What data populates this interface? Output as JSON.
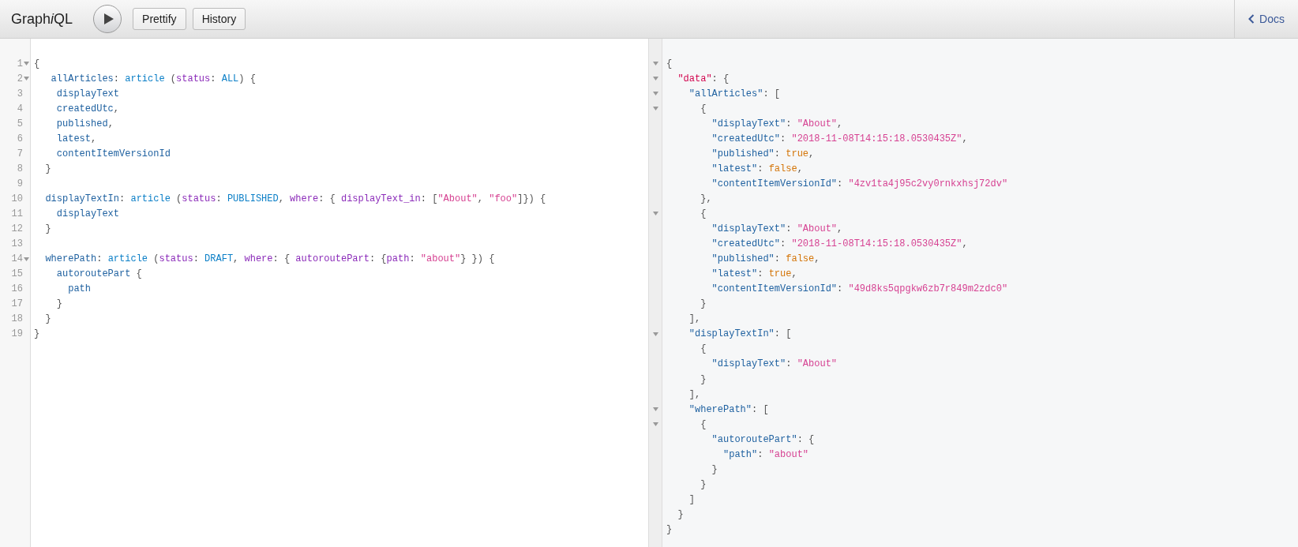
{
  "toolbar": {
    "title": [
      {
        "text": "Graph",
        "italic": false
      },
      {
        "text": "i",
        "italic": true
      },
      {
        "text": "QL",
        "italic": false
      }
    ],
    "buttons": [
      "Prettify",
      "History"
    ],
    "docs": "Docs"
  },
  "query_editor": {
    "lines": [
      {
        "number": "1",
        "foldable": true,
        "tokens": [
          {
            "kind": "punctuation",
            "text": "{"
          }
        ]
      },
      {
        "number": "2",
        "foldable": true,
        "tokens": [
          {
            "kind": "property",
            "text": "   allArticles"
          },
          {
            "kind": "punctuation",
            "text": ": "
          },
          {
            "kind": "type",
            "text": "article"
          },
          {
            "kind": "punctuation",
            "text": " ("
          },
          {
            "kind": "attribute",
            "text": "status"
          },
          {
            "kind": "punctuation",
            "text": ": "
          },
          {
            "kind": "enum",
            "text": "ALL"
          },
          {
            "kind": "punctuation",
            "text": ") {"
          }
        ]
      },
      {
        "number": "3",
        "foldable": false,
        "tokens": [
          {
            "kind": "property",
            "text": "    displayText"
          }
        ]
      },
      {
        "number": "4",
        "foldable": false,
        "tokens": [
          {
            "kind": "property",
            "text": "    createdUtc"
          },
          {
            "kind": "punctuation",
            "text": ","
          }
        ]
      },
      {
        "number": "5",
        "foldable": false,
        "tokens": [
          {
            "kind": "property",
            "text": "    published"
          },
          {
            "kind": "punctuation",
            "text": ","
          }
        ]
      },
      {
        "number": "6",
        "foldable": false,
        "tokens": [
          {
            "kind": "property",
            "text": "    latest"
          },
          {
            "kind": "punctuation",
            "text": ","
          }
        ]
      },
      {
        "number": "7",
        "foldable": false,
        "tokens": [
          {
            "kind": "property",
            "text": "    contentItemVersionId"
          }
        ]
      },
      {
        "number": "8",
        "foldable": false,
        "tokens": [
          {
            "kind": "punctuation",
            "text": "  }"
          }
        ]
      },
      {
        "number": "9",
        "foldable": false
      },
      {
        "number": "10",
        "foldable": false,
        "tokens": [
          {
            "kind": "property",
            "text": "  displayTextIn"
          },
          {
            "kind": "punctuation",
            "text": ": "
          },
          {
            "kind": "type",
            "text": "article"
          },
          {
            "kind": "punctuation",
            "text": " ("
          },
          {
            "kind": "attribute",
            "text": "status"
          },
          {
            "kind": "punctuation",
            "text": ": "
          },
          {
            "kind": "enum",
            "text": "PUBLISHED"
          },
          {
            "kind": "punctuation",
            "text": ", "
          },
          {
            "kind": "attribute",
            "text": "where"
          },
          {
            "kind": "punctuation",
            "text": ": { "
          },
          {
            "kind": "attribute",
            "text": "displayText_in"
          },
          {
            "kind": "punctuation",
            "text": ": ["
          },
          {
            "kind": "string",
            "text": "\"About\""
          },
          {
            "kind": "punctuation",
            "text": ", "
          },
          {
            "kind": "string",
            "text": "\"foo\""
          },
          {
            "kind": "punctuation",
            "text": "]}) {"
          }
        ]
      },
      {
        "number": "11",
        "foldable": false,
        "tokens": [
          {
            "kind": "property",
            "text": "    displayText"
          }
        ]
      },
      {
        "number": "12",
        "foldable": false,
        "tokens": [
          {
            "kind": "punctuation",
            "text": "  }"
          }
        ]
      },
      {
        "number": "13",
        "foldable": false
      },
      {
        "number": "14",
        "foldable": true,
        "tokens": [
          {
            "kind": "property",
            "text": "  wherePath"
          },
          {
            "kind": "punctuation",
            "text": ": "
          },
          {
            "kind": "type",
            "text": "article"
          },
          {
            "kind": "punctuation",
            "text": " ("
          },
          {
            "kind": "attribute",
            "text": "status"
          },
          {
            "kind": "punctuation",
            "text": ": "
          },
          {
            "kind": "enum",
            "text": "DRAFT"
          },
          {
            "kind": "punctuation",
            "text": ", "
          },
          {
            "kind": "attribute",
            "text": "where"
          },
          {
            "kind": "punctuation",
            "text": ": { "
          },
          {
            "kind": "attribute",
            "text": "autoroutePart"
          },
          {
            "kind": "punctuation",
            "text": ": {"
          },
          {
            "kind": "attribute",
            "text": "path"
          },
          {
            "kind": "punctuation",
            "text": ": "
          },
          {
            "kind": "string",
            "text": "\"about\""
          },
          {
            "kind": "punctuation",
            "text": "} }) {"
          }
        ]
      },
      {
        "number": "15",
        "foldable": false,
        "tokens": [
          {
            "kind": "property",
            "text": "    autoroutePart"
          },
          {
            "kind": "punctuation",
            "text": " {"
          }
        ]
      },
      {
        "number": "16",
        "foldable": false,
        "tokens": [
          {
            "kind": "property",
            "text": "      path"
          }
        ]
      },
      {
        "number": "17",
        "foldable": false,
        "tokens": [
          {
            "kind": "punctuation",
            "text": "    }"
          }
        ]
      },
      {
        "number": "18",
        "foldable": false,
        "tokens": [
          {
            "kind": "punctuation",
            "text": "  }"
          }
        ]
      },
      {
        "number": "19",
        "foldable": false,
        "tokens": [
          {
            "kind": "punctuation",
            "text": "}"
          }
        ]
      }
    ]
  },
  "result_viewer": {
    "lines": [
      {
        "foldable": true,
        "tokens": [
          {
            "kind": "punctuation",
            "text": "{"
          }
        ]
      },
      {
        "foldable": true,
        "tokens": [
          {
            "kind": "root-key",
            "text": "  \"data\""
          },
          {
            "kind": "punctuation",
            "text": ": {"
          }
        ]
      },
      {
        "foldable": true,
        "tokens": [
          {
            "kind": "property",
            "text": "    \"allArticles\""
          },
          {
            "kind": "punctuation",
            "text": ": ["
          }
        ]
      },
      {
        "foldable": true,
        "tokens": [
          {
            "kind": "punctuation",
            "text": "      {"
          }
        ]
      },
      {
        "foldable": false,
        "tokens": [
          {
            "kind": "property",
            "text": "        \"displayText\""
          },
          {
            "kind": "punctuation",
            "text": ": "
          },
          {
            "kind": "string",
            "text": "\"About\""
          },
          {
            "kind": "punctuation",
            "text": ","
          }
        ]
      },
      {
        "foldable": false,
        "tokens": [
          {
            "kind": "property",
            "text": "        \"createdUtc\""
          },
          {
            "kind": "punctuation",
            "text": ": "
          },
          {
            "kind": "string",
            "text": "\"2018-11-08T14:15:18.0530435Z\""
          },
          {
            "kind": "punctuation",
            "text": ","
          }
        ]
      },
      {
        "foldable": false,
        "tokens": [
          {
            "kind": "property",
            "text": "        \"published\""
          },
          {
            "kind": "punctuation",
            "text": ": "
          },
          {
            "kind": "boolean",
            "text": "true"
          },
          {
            "kind": "punctuation",
            "text": ","
          }
        ]
      },
      {
        "foldable": false,
        "tokens": [
          {
            "kind": "property",
            "text": "        \"latest\""
          },
          {
            "kind": "punctuation",
            "text": ": "
          },
          {
            "kind": "boolean",
            "text": "false"
          },
          {
            "kind": "punctuation",
            "text": ","
          }
        ]
      },
      {
        "foldable": false,
        "tokens": [
          {
            "kind": "property",
            "text": "        \"contentItemVersionId\""
          },
          {
            "kind": "punctuation",
            "text": ": "
          },
          {
            "kind": "string",
            "text": "\"4zv1ta4j95c2vy0rnkxhsj72dv\""
          }
        ]
      },
      {
        "foldable": false,
        "tokens": [
          {
            "kind": "punctuation",
            "text": "      },"
          }
        ]
      },
      {
        "foldable": true,
        "tokens": [
          {
            "kind": "punctuation",
            "text": "      {"
          }
        ]
      },
      {
        "foldable": false,
        "tokens": [
          {
            "kind": "property",
            "text": "        \"displayText\""
          },
          {
            "kind": "punctuation",
            "text": ": "
          },
          {
            "kind": "string",
            "text": "\"About\""
          },
          {
            "kind": "punctuation",
            "text": ","
          }
        ]
      },
      {
        "foldable": false,
        "tokens": [
          {
            "kind": "property",
            "text": "        \"createdUtc\""
          },
          {
            "kind": "punctuation",
            "text": ": "
          },
          {
            "kind": "string",
            "text": "\"2018-11-08T14:15:18.0530435Z\""
          },
          {
            "kind": "punctuation",
            "text": ","
          }
        ]
      },
      {
        "foldable": false,
        "tokens": [
          {
            "kind": "property",
            "text": "        \"published\""
          },
          {
            "kind": "punctuation",
            "text": ": "
          },
          {
            "kind": "boolean",
            "text": "false"
          },
          {
            "kind": "punctuation",
            "text": ","
          }
        ]
      },
      {
        "foldable": false,
        "tokens": [
          {
            "kind": "property",
            "text": "        \"latest\""
          },
          {
            "kind": "punctuation",
            "text": ": "
          },
          {
            "kind": "boolean",
            "text": "true"
          },
          {
            "kind": "punctuation",
            "text": ","
          }
        ]
      },
      {
        "foldable": false,
        "tokens": [
          {
            "kind": "property",
            "text": "        \"contentItemVersionId\""
          },
          {
            "kind": "punctuation",
            "text": ": "
          },
          {
            "kind": "string",
            "text": "\"49d8ks5qpgkw6zb7r849m2zdc0\""
          }
        ]
      },
      {
        "foldable": false,
        "tokens": [
          {
            "kind": "punctuation",
            "text": "      }"
          }
        ]
      },
      {
        "foldable": false,
        "tokens": [
          {
            "kind": "punctuation",
            "text": "    ],"
          }
        ]
      },
      {
        "foldable": true,
        "tokens": [
          {
            "kind": "property",
            "text": "    \"displayTextIn\""
          },
          {
            "kind": "punctuation",
            "text": ": ["
          }
        ]
      },
      {
        "foldable": false,
        "tokens": [
          {
            "kind": "punctuation",
            "text": "      {"
          }
        ]
      },
      {
        "foldable": false,
        "tokens": [
          {
            "kind": "property",
            "text": "        \"displayText\""
          },
          {
            "kind": "punctuation",
            "text": ": "
          },
          {
            "kind": "string",
            "text": "\"About\""
          }
        ]
      },
      {
        "foldable": false,
        "tokens": [
          {
            "kind": "punctuation",
            "text": "      }"
          }
        ]
      },
      {
        "foldable": false,
        "tokens": [
          {
            "kind": "punctuation",
            "text": "    ],"
          }
        ]
      },
      {
        "foldable": true,
        "tokens": [
          {
            "kind": "property",
            "text": "    \"wherePath\""
          },
          {
            "kind": "punctuation",
            "text": ": ["
          }
        ]
      },
      {
        "foldable": true,
        "tokens": [
          {
            "kind": "punctuation",
            "text": "      {"
          }
        ]
      },
      {
        "foldable": false,
        "tokens": [
          {
            "kind": "property",
            "text": "        \"autoroutePart\""
          },
          {
            "kind": "punctuation",
            "text": ": {"
          }
        ]
      },
      {
        "foldable": false,
        "tokens": [
          {
            "kind": "property",
            "text": "          \"path\""
          },
          {
            "kind": "punctuation",
            "text": ": "
          },
          {
            "kind": "string",
            "text": "\"about\""
          }
        ]
      },
      {
        "foldable": false,
        "tokens": [
          {
            "kind": "punctuation",
            "text": "        }"
          }
        ]
      },
      {
        "foldable": false,
        "tokens": [
          {
            "kind": "punctuation",
            "text": "      }"
          }
        ]
      },
      {
        "foldable": false,
        "tokens": [
          {
            "kind": "punctuation",
            "text": "    ]"
          }
        ]
      },
      {
        "foldable": false,
        "tokens": [
          {
            "kind": "punctuation",
            "text": "  }"
          }
        ]
      },
      {
        "foldable": false,
        "tokens": [
          {
            "kind": "punctuation",
            "text": "}"
          }
        ]
      }
    ]
  }
}
